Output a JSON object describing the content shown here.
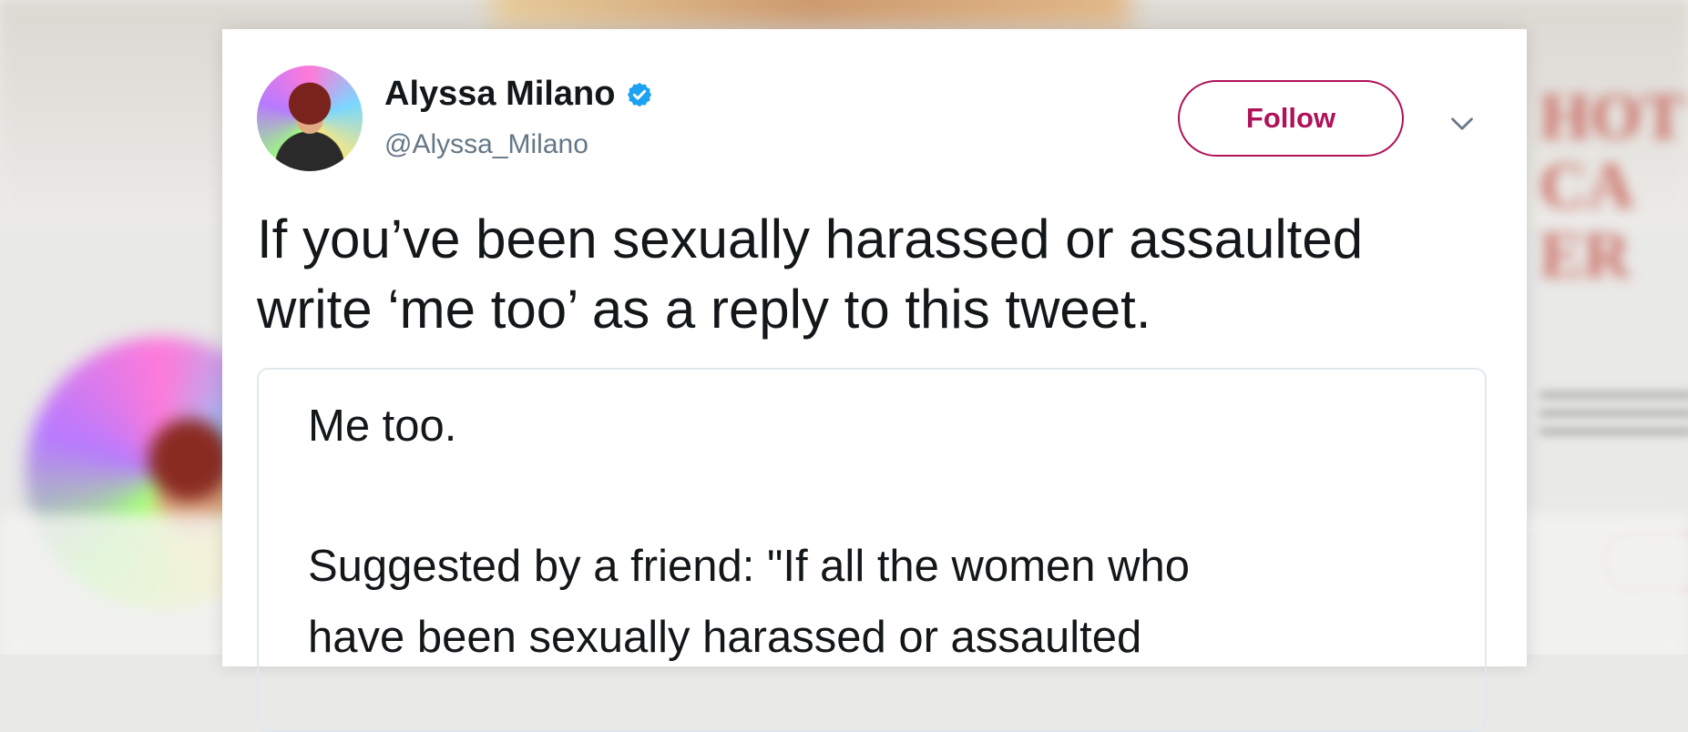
{
  "tweet": {
    "author_name": "Alyssa Milano",
    "author_handle": "@Alyssa_Milano",
    "follow_label": "Follow",
    "text_lines": [
      "If you’ve been sexually harassed or assaulted",
      "write ‘me too’ as a reply to this tweet."
    ],
    "attached_note_lines": [
      "Me too.",
      "Suggested by a friend: \"If all the women who",
      "have been sexually harassed or assaulted"
    ]
  },
  "background": {
    "blurred_text": "HOT\nCA\nER"
  },
  "colors": {
    "follow_accent": "#b01259",
    "verified_badge": "#1da1f2",
    "handle_gray": "#657786",
    "text_dark": "#14171a"
  },
  "icons": {
    "verified": "verified-badge-icon",
    "menu": "chevron-down-icon"
  }
}
